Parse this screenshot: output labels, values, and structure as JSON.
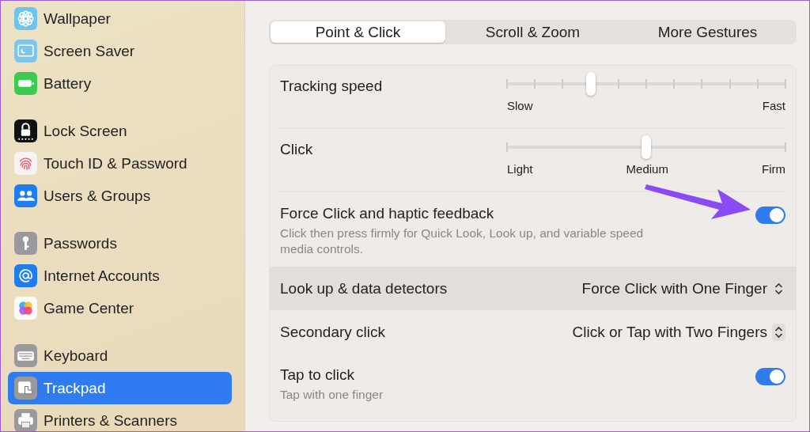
{
  "sidebar": {
    "groups": [
      [
        {
          "label": "Wallpaper",
          "selected": false
        },
        {
          "label": "Screen Saver",
          "selected": false
        },
        {
          "label": "Battery",
          "selected": false
        }
      ],
      [
        {
          "label": "Lock Screen",
          "selected": false
        },
        {
          "label": "Touch ID & Password",
          "selected": false
        },
        {
          "label": "Users & Groups",
          "selected": false
        }
      ],
      [
        {
          "label": "Passwords",
          "selected": false
        },
        {
          "label": "Internet Accounts",
          "selected": false
        },
        {
          "label": "Game Center",
          "selected": false
        }
      ],
      [
        {
          "label": "Keyboard",
          "selected": false
        },
        {
          "label": "Trackpad",
          "selected": true
        },
        {
          "label": "Printers & Scanners",
          "selected": false
        }
      ]
    ]
  },
  "tabs": [
    {
      "label": "Point & Click",
      "selected": true
    },
    {
      "label": "Scroll & Zoom",
      "selected": false
    },
    {
      "label": "More Gestures",
      "selected": false
    }
  ],
  "settings": [
    {
      "kind": "slider",
      "label": "Tracking speed",
      "level": 0.3,
      "ticks": true,
      "scale": [
        "Slow",
        "Fast"
      ]
    },
    {
      "kind": "slider",
      "label": "Click",
      "level": 0.5,
      "ticks": false,
      "scale": [
        "Light",
        "Medium",
        "Firm"
      ]
    },
    {
      "kind": "toggle",
      "label": "Force Click and haptic feedback",
      "description": "Click then press firmly for Quick Look, Look up, and variable speed media controls.",
      "on": true
    },
    {
      "kind": "popup",
      "label": "Look up & data detectors",
      "value": "Force Click with One Finger",
      "selected": true
    },
    {
      "kind": "popup",
      "label": "Secondary click",
      "value": "Click or Tap with Two Fingers",
      "selected": false
    },
    {
      "kind": "toggle",
      "label": "Tap to click",
      "description": "Tap with one finger",
      "on": true
    }
  ]
}
